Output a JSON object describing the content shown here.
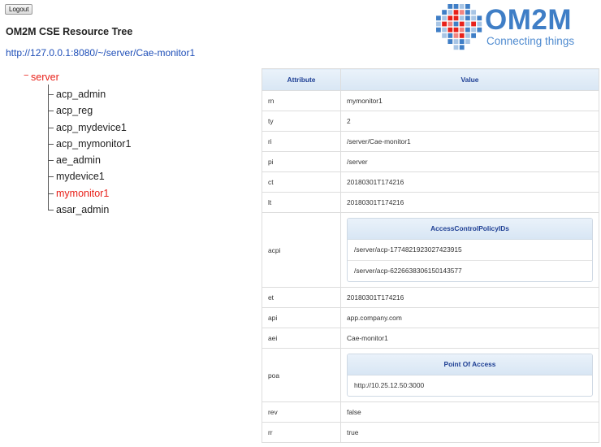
{
  "header": {
    "logout_label": "Logout",
    "title": "OM2M CSE Resource Tree",
    "url": "http://127.0.0.1:8080/~/server/Cae-monitor1"
  },
  "logo": {
    "name": "OM2M",
    "tagline": "Connecting things"
  },
  "tree": {
    "root": "server",
    "children": [
      "acp_admin",
      "acp_reg",
      "acp_mydevice1",
      "acp_mymonitor1",
      "ae_admin",
      "mydevice1",
      "mymonitor1",
      "asar_admin"
    ],
    "selected": "mymonitor1"
  },
  "table": {
    "headers": {
      "attribute": "Attribute",
      "value": "Value"
    },
    "rows": {
      "rn": {
        "key": "rn",
        "value": "mymonitor1"
      },
      "ty": {
        "key": "ty",
        "value": "2"
      },
      "ri": {
        "key": "ri",
        "value": "/server/Cae-monitor1"
      },
      "pi": {
        "key": "pi",
        "value": "/server"
      },
      "ct": {
        "key": "ct",
        "value": "20180301T174216"
      },
      "lt": {
        "key": "lt",
        "value": "20180301T174216"
      },
      "acpi": {
        "key": "acpi",
        "sub_title": "AccessControlPolicyIDs",
        "items": [
          "/server/acp-1774821923027423915",
          "/server/acp-6226638306150143577"
        ]
      },
      "et": {
        "key": "et",
        "value": "20180301T174216"
      },
      "api": {
        "key": "api",
        "value": "app.company.com"
      },
      "aei": {
        "key": "aei",
        "value": "Cae-monitor1"
      },
      "poa": {
        "key": "poa",
        "sub_title": "Point Of Access",
        "items": [
          "http://10.25.12.50:3000"
        ]
      },
      "rev": {
        "key": "rev",
        "value": "false"
      },
      "rr": {
        "key": "rr",
        "value": "true"
      }
    }
  },
  "colors": {
    "link": "#1f4fb8",
    "selected": "#e8211a",
    "header_text": "#1e3f94",
    "header_bg": "#dfeaf6",
    "logo_blue": "#3f7ec6",
    "logo_red": "#e8211a"
  }
}
